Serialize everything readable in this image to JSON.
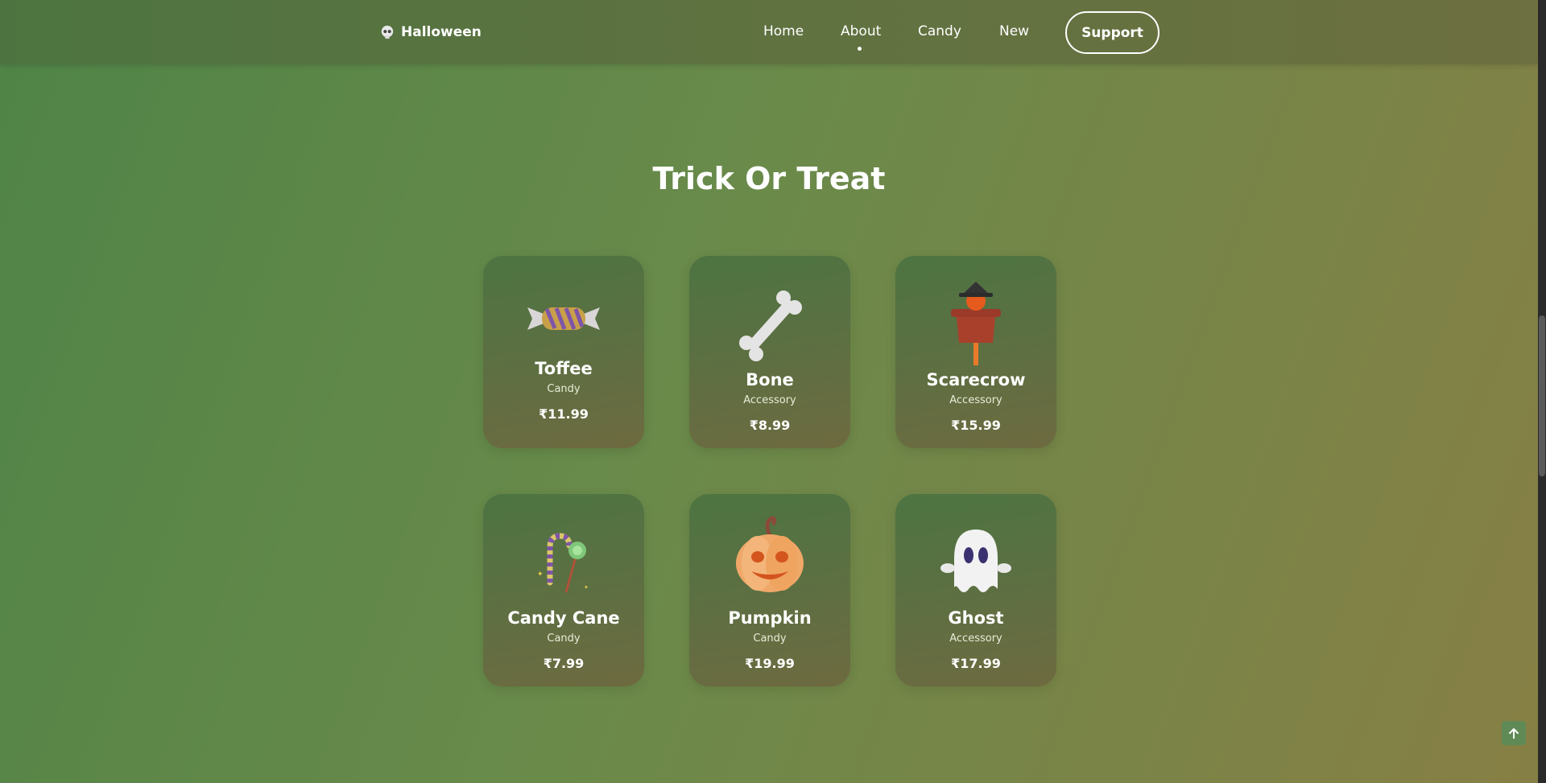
{
  "header": {
    "logo_text": "Halloween",
    "nav": [
      "Home",
      "About",
      "Candy",
      "New"
    ],
    "active_nav": "About",
    "support_label": "Support"
  },
  "section": {
    "title": "Trick Or Treat"
  },
  "products": [
    {
      "name": "Toffee",
      "category": "Candy",
      "price": "₹11.99",
      "icon": "toffee-icon"
    },
    {
      "name": "Bone",
      "category": "Accessory",
      "price": "₹8.99",
      "icon": "bone-icon"
    },
    {
      "name": "Scarecrow",
      "category": "Accessory",
      "price": "₹15.99",
      "icon": "scarecrow-icon"
    },
    {
      "name": "Candy Cane",
      "category": "Candy",
      "price": "₹7.99",
      "icon": "candy-cane-icon"
    },
    {
      "name": "Pumpkin",
      "category": "Candy",
      "price": "₹19.99",
      "icon": "pumpkin-icon"
    },
    {
      "name": "Ghost",
      "category": "Accessory",
      "price": "₹17.99",
      "icon": "ghost-icon"
    }
  ],
  "colors": {
    "background_start": "#4f8447",
    "background_end": "#877f45",
    "card": "#5e6f42",
    "text": "#ffffff"
  }
}
